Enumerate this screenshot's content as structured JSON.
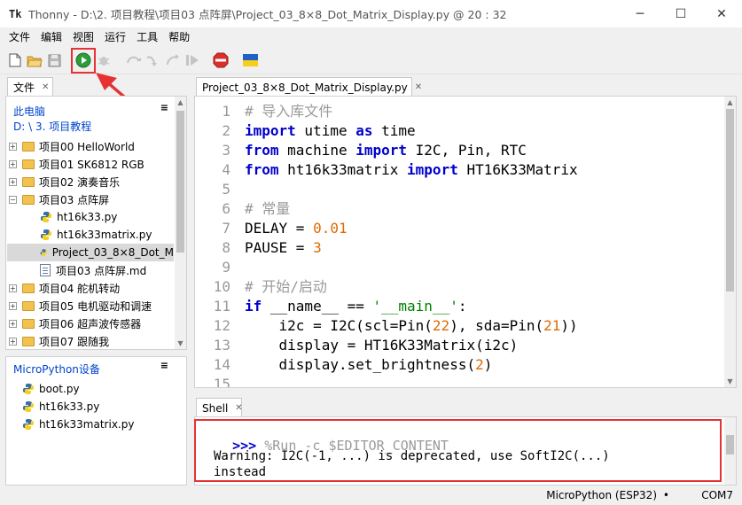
{
  "window": {
    "app_logo": "Tk",
    "title": "Thonny  -  D:\\2. 项目教程\\项目03  点阵屏\\Project_03_8×8_Dot_Matrix_Display.py  @  20 : 32",
    "minimize": "─",
    "maximize": "☐",
    "close": "✕"
  },
  "menu": [
    "文件",
    "编辑",
    "视图",
    "运行",
    "工具",
    "帮助"
  ],
  "files_panel": {
    "tab_label": "文件",
    "this_computer": "此电脑",
    "path": "D: \\ 3. 项目教程",
    "tree": [
      {
        "label": "项目00 HelloWorld",
        "type": "folder",
        "expander": "+"
      },
      {
        "label": "项目01 SK6812 RGB",
        "type": "folder",
        "expander": "+"
      },
      {
        "label": "项目02 演奏音乐",
        "type": "folder",
        "expander": "+"
      },
      {
        "label": "项目03  点阵屏",
        "type": "folder",
        "expander": "−"
      },
      {
        "label": "ht16k33.py",
        "type": "py"
      },
      {
        "label": "ht16k33matrix.py",
        "type": "py"
      },
      {
        "label": "Project_03_8×8_Dot_M",
        "type": "py",
        "selected": true
      },
      {
        "label": "项目03  点阵屏.md",
        "type": "md"
      },
      {
        "label": "项目04 舵机转动",
        "type": "folder",
        "expander": "+"
      },
      {
        "label": "项目05 电机驱动和调速",
        "type": "folder",
        "expander": "+"
      },
      {
        "label": "项目06 超声波传感器",
        "type": "folder",
        "expander": "+"
      },
      {
        "label": "项目07 跟随我",
        "type": "folder",
        "expander": "+"
      }
    ],
    "device_title": "MicroPython设备",
    "device_files": [
      "boot.py",
      "ht16k33.py",
      "ht16k33matrix.py"
    ]
  },
  "editor": {
    "tab_label": "Project_03_8×8_Dot_Matrix_Display.py",
    "lines": [
      [
        {
          "t": "# 导入库文件",
          "c": "cm"
        }
      ],
      [
        {
          "t": "import",
          "c": "kw"
        },
        {
          "t": " utime "
        },
        {
          "t": "as",
          "c": "kw"
        },
        {
          "t": " time"
        }
      ],
      [
        {
          "t": "from",
          "c": "kw"
        },
        {
          "t": " machine "
        },
        {
          "t": "import",
          "c": "kw"
        },
        {
          "t": " I2C, Pin, RTC"
        }
      ],
      [
        {
          "t": "from",
          "c": "kw"
        },
        {
          "t": " ht16k33matrix "
        },
        {
          "t": "import",
          "c": "kw"
        },
        {
          "t": " HT16K33Matrix"
        }
      ],
      [],
      [
        {
          "t": "# 常量",
          "c": "cm"
        }
      ],
      [
        {
          "t": "DELAY = "
        },
        {
          "t": "0.01",
          "c": "num"
        }
      ],
      [
        {
          "t": "PAUSE = "
        },
        {
          "t": "3",
          "c": "num"
        }
      ],
      [],
      [
        {
          "t": "# 开始/启动",
          "c": "cm"
        }
      ],
      [
        {
          "t": "if",
          "c": "kw"
        },
        {
          "t": " __name__ == "
        },
        {
          "t": "'__main__'",
          "c": "str"
        },
        {
          "t": ":"
        }
      ],
      [
        {
          "t": "    i2c = I2C(scl=Pin("
        },
        {
          "t": "22",
          "c": "num"
        },
        {
          "t": "), sda=Pin("
        },
        {
          "t": "21",
          "c": "num"
        },
        {
          "t": "))"
        }
      ],
      [
        {
          "t": "    display = HT16K33Matrix(i2c)"
        }
      ],
      [
        {
          "t": "    display.set_brightness("
        },
        {
          "t": "2",
          "c": "num"
        },
        {
          "t": ")"
        }
      ],
      [
        {
          "t": ""
        }
      ]
    ]
  },
  "shell": {
    "tab_label": "Shell",
    "prompt": ">>>",
    "command": " %Run -c $EDITOR_CONTENT",
    "warning_line1": "Warning: I2C(-1, ...) is deprecated, use SoftI2C(...)",
    "warning_line2": "instead"
  },
  "status": {
    "interpreter": "MicroPython (ESP32)",
    "separator": "•",
    "port": "COM7"
  },
  "colors": {
    "highlight": "#e53333",
    "keyword": "#0000cc",
    "comment": "#9a9a9a",
    "number": "#e06a00",
    "string": "#008000",
    "folder": "#f2c14e",
    "link_blue": "#0044cc"
  }
}
